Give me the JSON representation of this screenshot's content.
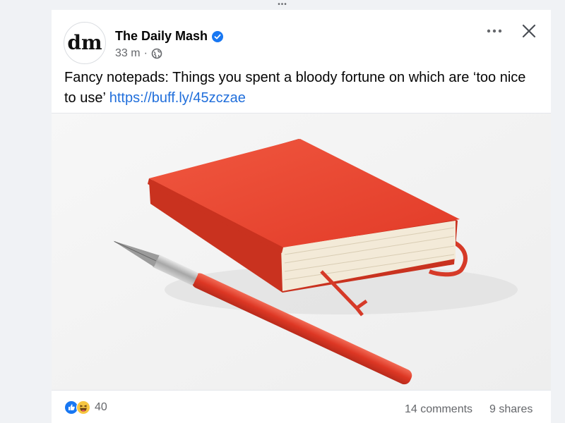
{
  "drag_handle": {
    "glyph": "•••"
  },
  "post": {
    "author": {
      "name": "The Daily Mash",
      "avatar_text": "dm",
      "verified": true
    },
    "timestamp": "33 m",
    "separator": "·",
    "audience_icon": "globe-icon",
    "text": "Fancy notepads: Things you spent a bloody fortune on which are ‘too nice to use’",
    "link": "https://buff.ly/45zczae",
    "image_subject": "red notebook with red pen"
  },
  "actions": {
    "more_icon": "more-icon",
    "close_icon": "close-icon"
  },
  "stats": {
    "reaction_icons": [
      "like-icon",
      "haha-icon"
    ],
    "reaction_count": "40",
    "comments": "14 comments",
    "shares": "9 shares"
  },
  "colors": {
    "link": "#216fdb",
    "verified": "#1877f2",
    "secondary_text": "#65676b",
    "notebook": "#e8432e"
  }
}
